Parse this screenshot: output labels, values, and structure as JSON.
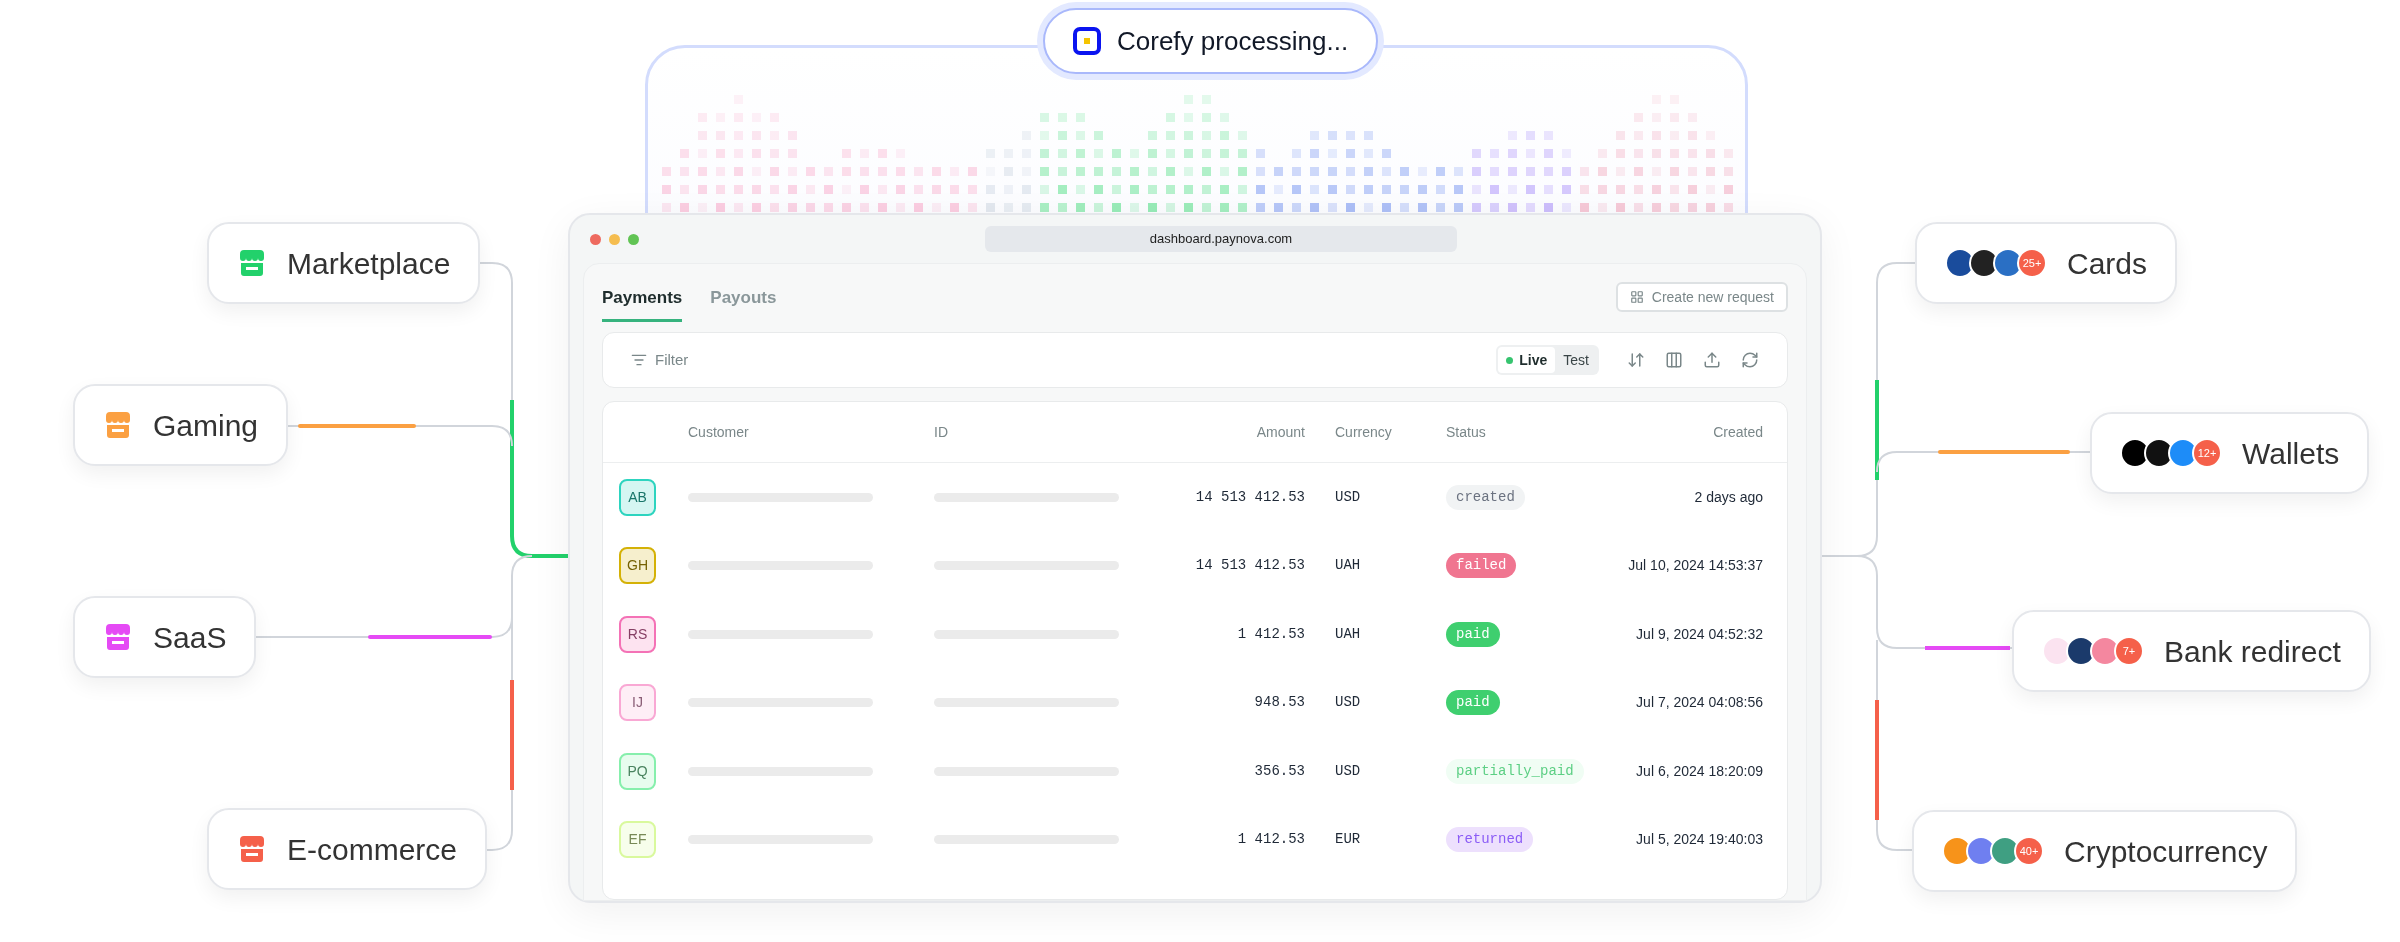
{
  "processing": {
    "label": "Corefy processing..."
  },
  "window": {
    "url": "dashboard.paynova.com"
  },
  "tabs": [
    {
      "label": "Payments",
      "selected": true
    },
    {
      "label": "Payouts",
      "selected": false
    }
  ],
  "create_button": "Create new request",
  "filter": {
    "label": "Filter"
  },
  "mode_toggle": [
    {
      "label": "Live",
      "selected": true
    },
    {
      "label": "Test",
      "selected": false
    }
  ],
  "table": {
    "columns": [
      "Customer",
      "ID",
      "Amount",
      "Currency",
      "Status",
      "Created"
    ],
    "rows": [
      {
        "avatar": {
          "initials": "AB",
          "color": "#2dd4bf"
        },
        "amount": "14 513 412.53",
        "currency": "USD",
        "status": {
          "label": "created",
          "kind": "created"
        },
        "created": "2 days ago"
      },
      {
        "avatar": {
          "initials": "GH",
          "color": "#d4b106"
        },
        "amount": "14 513 412.53",
        "currency": "UAH",
        "status": {
          "label": "failed",
          "kind": "failed"
        },
        "created": "Jul 10, 2024 14:53:37"
      },
      {
        "avatar": {
          "initials": "RS",
          "color": "#f472b6"
        },
        "amount": "1 412.53",
        "currency": "UAH",
        "status": {
          "label": "paid",
          "kind": "paid"
        },
        "created": "Jul 9, 2024 04:52:32"
      },
      {
        "avatar": {
          "initials": "IJ",
          "color": "#f9a8d4"
        },
        "amount": "948.53",
        "currency": "USD",
        "status": {
          "label": "paid",
          "kind": "paid"
        },
        "created": "Jul 7, 2024 04:08:56"
      },
      {
        "avatar": {
          "initials": "PQ",
          "color": "#86efac"
        },
        "amount": "356.53",
        "currency": "USD",
        "status": {
          "label": "partially_paid",
          "kind": "partial"
        },
        "created": "Jul 6, 2024 18:20:09"
      },
      {
        "avatar": {
          "initials": "EF",
          "color": "#d9f99d"
        },
        "amount": "1 412.53",
        "currency": "EUR",
        "status": {
          "label": "returned",
          "kind": "returned"
        },
        "created": "Jul 5, 2024 19:40:03"
      }
    ]
  },
  "sources": [
    {
      "label": "Marketplace",
      "color": "#22d16b"
    },
    {
      "label": "Gaming",
      "color": "#fba042"
    },
    {
      "label": "SaaS",
      "color": "#e54af5"
    },
    {
      "label": "E-commerce",
      "color": "#f5604a"
    }
  ],
  "methods": [
    {
      "label": "Cards",
      "count": "25+",
      "logos": [
        {
          "color": "#1a4c9c"
        },
        {
          "color": "#222222"
        },
        {
          "color": "#2a6fc4"
        }
      ]
    },
    {
      "label": "Wallets",
      "count": "12+",
      "logos": [
        {
          "color": "#000000"
        },
        {
          "color": "#111111"
        },
        {
          "color": "#1d8cf8"
        }
      ]
    },
    {
      "label": "Bank redirect",
      "count": "7+",
      "logos": [
        {
          "color": "#fbe3f0"
        },
        {
          "color": "#1b3a6b"
        },
        {
          "color": "#f4879f"
        }
      ]
    },
    {
      "label": "Cryptocurrency",
      "count": "40+",
      "logos": [
        {
          "color": "#f7931a"
        },
        {
          "color": "#6f7ff0"
        },
        {
          "color": "#3f9f82"
        }
      ]
    }
  ]
}
